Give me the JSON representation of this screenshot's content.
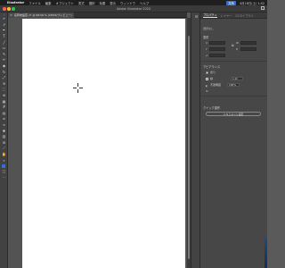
{
  "menubar": {
    "app": "Illustrator",
    "items": [
      "ファイル",
      "編集",
      "オブジェクト",
      "書式",
      "選択",
      "効果",
      "表示",
      "ウィンドウ",
      "ヘルプ"
    ],
    "share_label": "共有",
    "clock": "4月18日(土) 1:42"
  },
  "window": {
    "title": "Adobe Illustrator 2020"
  },
  "document": {
    "tab_label": "名称未設定-1* @ 98.56 % (CMYK/プレビュー)"
  },
  "panel": {
    "tabs": [
      "プロパティ",
      "レイヤー",
      "CCライブラリ"
    ],
    "no_selection": "選択なし",
    "transform_label": "変形",
    "appearance_label": "アピアランス",
    "fill_label": "塗り",
    "stroke_label": "線",
    "stroke_value": "1 pt",
    "opacity_label": "不透明度",
    "opacity_value": "100%",
    "quick_actions_label": "クイック操作",
    "quick_action_button": "ドキュメント設定",
    "fx_label": "fx"
  },
  "colors": {
    "accent": "#2f6fd6",
    "canvas_bg": "#535353",
    "artboard": "#ffffff",
    "panel_bg": "#474747"
  },
  "icons": [
    "apple-icon",
    "selection-tool-icon",
    "direct-selection-icon",
    "pen-tool-icon",
    "type-tool-icon",
    "line-tool-icon",
    "rectangle-tool-icon",
    "brush-tool-icon",
    "pencil-tool-icon",
    "eraser-tool-icon",
    "rotate-tool-icon",
    "scale-tool-icon",
    "warp-tool-icon",
    "free-transform-icon",
    "shape-builder-icon",
    "perspective-grid-icon",
    "mesh-tool-icon",
    "gradient-tool-icon",
    "eyedropper-tool-icon",
    "blend-tool-icon",
    "symbol-sprayer-icon",
    "graph-tool-icon",
    "artboard-tool-icon",
    "slice-tool-icon",
    "hand-tool-icon",
    "zoom-tool-icon",
    "fill-stroke-swatch-icon",
    "screen-mode-icon",
    "more-tools-icon"
  ]
}
